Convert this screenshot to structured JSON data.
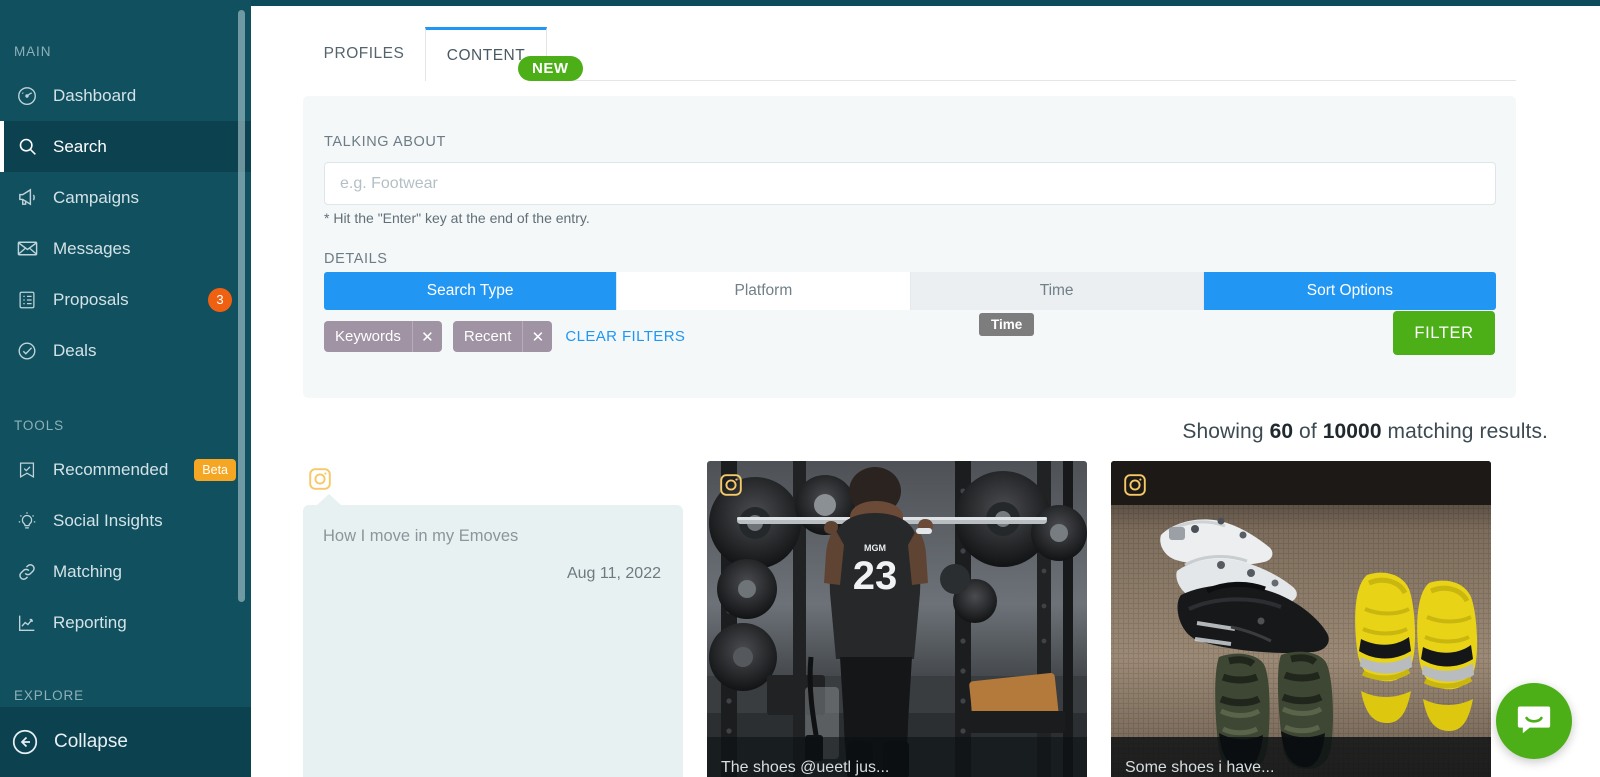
{
  "theme": {
    "sidebar_bg": "#10505f",
    "sidebar_active_bg": "#0c4150",
    "accent_blue": "#2196f3",
    "accent_green": "#4caf17",
    "badge_orange": "#ef6111",
    "badge_amber": "#f5a623",
    "chip_purple": "#9f93a4",
    "panel_bg": "#f4f8f9",
    "bubble_bg": "#e8f1f2",
    "instagram_badge": "#f5c868"
  },
  "sidebar": {
    "sections": [
      {
        "label": "MAIN",
        "items": [
          {
            "label": "Dashboard",
            "icon": "gauge-icon",
            "active": false,
            "badge": null
          },
          {
            "label": "Search",
            "icon": "search-icon",
            "active": true,
            "badge": null
          },
          {
            "label": "Campaigns",
            "icon": "megaphone-icon",
            "active": false,
            "badge": null
          },
          {
            "label": "Messages",
            "icon": "envelope-icon",
            "active": false,
            "badge": null
          },
          {
            "label": "Proposals",
            "icon": "clipboard-list-icon",
            "active": false,
            "badge": "3",
            "badge_type": "round"
          },
          {
            "label": "Deals",
            "icon": "check-circle-icon",
            "active": false,
            "badge": null
          }
        ]
      },
      {
        "label": "TOOLS",
        "items": [
          {
            "label": "Recommended",
            "icon": "bookmark-check-icon",
            "active": false,
            "badge": "Beta",
            "badge_type": "pill"
          },
          {
            "label": "Social Insights",
            "icon": "lightbulb-icon",
            "active": false,
            "badge": null
          },
          {
            "label": "Matching",
            "icon": "link-icon",
            "active": false,
            "badge": null
          },
          {
            "label": "Reporting",
            "icon": "chart-line-icon",
            "active": false,
            "badge": null
          }
        ]
      },
      {
        "label": "EXPLORE",
        "items": []
      }
    ],
    "collapse_label": "Collapse",
    "collapse_icon": "arrow-left-circle-icon"
  },
  "tabs": [
    {
      "label": "PROFILES",
      "active": false
    },
    {
      "label": "CONTENT",
      "active": true,
      "badge": "NEW"
    }
  ],
  "search_panel": {
    "talking_about_label": "TALKING ABOUT",
    "talking_about_value": "",
    "talking_about_placeholder": "e.g. Footwear",
    "hint": "* Hit the \"Enter\" key at the end of the entry.",
    "details_label": "DETAILS",
    "segments": [
      {
        "label": "Search Type",
        "state": "selected"
      },
      {
        "label": "Platform",
        "state": "default"
      },
      {
        "label": "Time",
        "state": "hovered"
      },
      {
        "label": "Sort Options",
        "state": "selected"
      }
    ],
    "chips": [
      {
        "label": "Keywords",
        "remove_icon": "close-icon"
      },
      {
        "label": "Recent",
        "remove_icon": "close-icon"
      }
    ],
    "clear_filters_label": "CLEAR FILTERS",
    "tooltip": "Time",
    "filter_button_label": "FILTER"
  },
  "results": {
    "count_prefix": "Showing ",
    "shown": "60",
    "count_middle": " of ",
    "total": "10000",
    "count_suffix": " matching results.",
    "cards": [
      {
        "type": "text",
        "platform_icon": "instagram-icon",
        "text": "How I move in my Emoves",
        "date": "Aug 11, 2022"
      },
      {
        "type": "photo",
        "platform_icon": "instagram-icon",
        "alt": "Athlete in black 23 jersey performing a barbell back squat in a gym power rack surrounded by weight plates",
        "caption": "The shoes @ueetl jus..."
      },
      {
        "type": "photo",
        "platform_icon": "instagram-icon",
        "alt": "Pile of sneakers and sandals on carpet: white high-tops, black trainers, camo shoes and yellow slides",
        "caption": "Some shoes i have..."
      }
    ]
  },
  "chat_launcher": {
    "icon": "chat-bubble-icon",
    "label": "Open messenger"
  }
}
